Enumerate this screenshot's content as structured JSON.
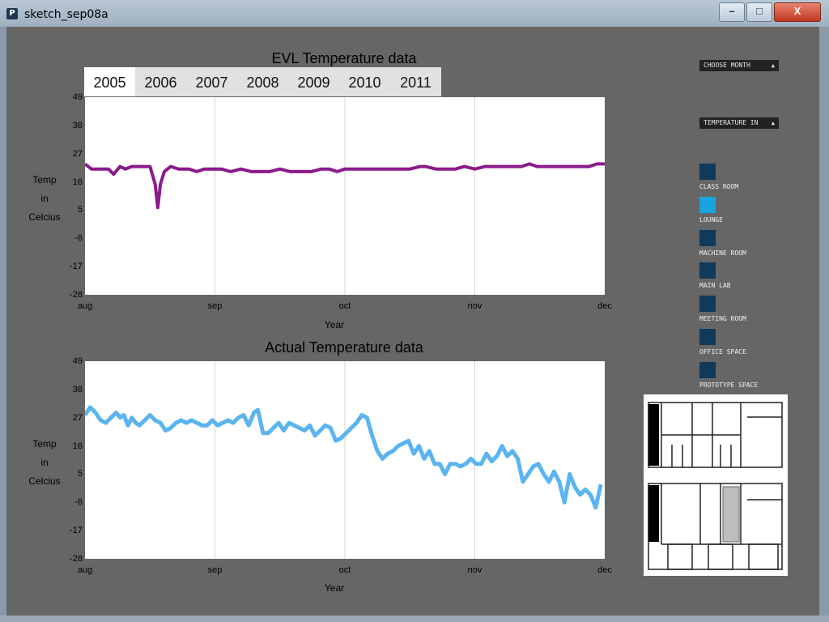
{
  "window": {
    "title": "sketch_sep08a",
    "app_icon": "processing-p-icon",
    "controls": {
      "minimize": "–",
      "maximize": "□",
      "close": "X"
    }
  },
  "tabs": [
    "2005",
    "2006",
    "2007",
    "2008",
    "2009",
    "2010",
    "2011"
  ],
  "selected_tab": "2005",
  "controls": {
    "choose_month": "CHOOSE MONTH",
    "temperature_in": "TEMPERATURE IN"
  },
  "rooms": [
    {
      "label": "CLASS ROOM",
      "color": "#0f3a5c"
    },
    {
      "label": "LOUNGE",
      "color": "#1aa3e0"
    },
    {
      "label": "MACHINE ROOM",
      "color": "#0f3a5c"
    },
    {
      "label": "MAIN LAB",
      "color": "#0f3a5c"
    },
    {
      "label": "MEETING ROOM",
      "color": "#0f3a5c"
    },
    {
      "label": "OFFICE SPACE",
      "color": "#0f3a5c"
    },
    {
      "label": "PROTOTYPE SPACE",
      "color": "#0f3a5c"
    }
  ],
  "chart_data": [
    {
      "type": "line",
      "title": "EVL Temperature data",
      "xlabel": "Year",
      "ylabel_lines": [
        "Temp",
        "in",
        "Celcius"
      ],
      "x_ticks": [
        "aug",
        "sep",
        "oct",
        "nov",
        "dec"
      ],
      "y_ticks": [
        49,
        38,
        27,
        16,
        5,
        -6,
        -17,
        -28
      ],
      "ylim": [
        -28,
        49
      ],
      "xlim": [
        0,
        4
      ],
      "grid": "vertical",
      "series": [
        {
          "color": "#8b1a8b",
          "points": [
            [
              0.0,
              23
            ],
            [
              0.05,
              21
            ],
            [
              0.12,
              21
            ],
            [
              0.18,
              21
            ],
            [
              0.22,
              19
            ],
            [
              0.27,
              22
            ],
            [
              0.31,
              21
            ],
            [
              0.36,
              22
            ],
            [
              0.42,
              22
            ],
            [
              0.47,
              22
            ],
            [
              0.5,
              22
            ],
            [
              0.54,
              15
            ],
            [
              0.56,
              6
            ],
            [
              0.58,
              15
            ],
            [
              0.61,
              20
            ],
            [
              0.66,
              22
            ],
            [
              0.72,
              21
            ],
            [
              0.8,
              21
            ],
            [
              0.86,
              20
            ],
            [
              0.92,
              21
            ],
            [
              0.98,
              21
            ],
            [
              1.05,
              21
            ],
            [
              1.12,
              20
            ],
            [
              1.2,
              21
            ],
            [
              1.28,
              20
            ],
            [
              1.34,
              20
            ],
            [
              1.42,
              20
            ],
            [
              1.5,
              21
            ],
            [
              1.58,
              20
            ],
            [
              1.66,
              20
            ],
            [
              1.74,
              20
            ],
            [
              1.82,
              21
            ],
            [
              1.88,
              21
            ],
            [
              1.94,
              20
            ],
            [
              2.0,
              21
            ],
            [
              2.1,
              21
            ],
            [
              2.2,
              21
            ],
            [
              2.3,
              21
            ],
            [
              2.4,
              21
            ],
            [
              2.5,
              21
            ],
            [
              2.58,
              22
            ],
            [
              2.62,
              22
            ],
            [
              2.7,
              21
            ],
            [
              2.78,
              21
            ],
            [
              2.85,
              21
            ],
            [
              2.92,
              22
            ],
            [
              3.0,
              21
            ],
            [
              3.08,
              22
            ],
            [
              3.14,
              22
            ],
            [
              3.22,
              22
            ],
            [
              3.28,
              22
            ],
            [
              3.36,
              22
            ],
            [
              3.42,
              23
            ],
            [
              3.48,
              22
            ],
            [
              3.56,
              22
            ],
            [
              3.64,
              22
            ],
            [
              3.72,
              22
            ],
            [
              3.8,
              22
            ],
            [
              3.88,
              22
            ],
            [
              3.94,
              23
            ],
            [
              4.0,
              23
            ]
          ]
        }
      ]
    },
    {
      "type": "line",
      "title": "Actual Temperature data",
      "xlabel": "Year",
      "ylabel_lines": [
        "Temp",
        "in",
        "Celcius"
      ],
      "x_ticks": [
        "aug",
        "sep",
        "oct",
        "nov",
        "dec"
      ],
      "y_ticks": [
        49,
        38,
        27,
        16,
        5,
        -6,
        -17,
        -28
      ],
      "ylim": [
        -28,
        49
      ],
      "xlim": [
        0,
        4
      ],
      "grid": "vertical",
      "series": [
        {
          "color": "#5ab4ef",
          "points": [
            [
              0.0,
              28
            ],
            [
              0.04,
              31
            ],
            [
              0.08,
              29
            ],
            [
              0.12,
              26
            ],
            [
              0.16,
              25
            ],
            [
              0.2,
              27
            ],
            [
              0.24,
              29
            ],
            [
              0.27,
              27
            ],
            [
              0.3,
              28
            ],
            [
              0.33,
              24
            ],
            [
              0.36,
              27
            ],
            [
              0.39,
              25
            ],
            [
              0.42,
              24
            ],
            [
              0.46,
              26
            ],
            [
              0.5,
              28
            ],
            [
              0.54,
              26
            ],
            [
              0.58,
              25
            ],
            [
              0.62,
              22
            ],
            [
              0.66,
              23
            ],
            [
              0.7,
              25
            ],
            [
              0.74,
              26
            ],
            [
              0.78,
              25
            ],
            [
              0.82,
              26
            ],
            [
              0.86,
              25
            ],
            [
              0.9,
              24
            ],
            [
              0.94,
              24
            ],
            [
              0.98,
              26
            ],
            [
              1.02,
              24
            ],
            [
              1.06,
              25
            ],
            [
              1.1,
              26
            ],
            [
              1.14,
              25
            ],
            [
              1.18,
              27
            ],
            [
              1.22,
              28
            ],
            [
              1.26,
              24
            ],
            [
              1.3,
              29
            ],
            [
              1.33,
              30
            ],
            [
              1.37,
              21
            ],
            [
              1.41,
              21
            ],
            [
              1.45,
              23
            ],
            [
              1.49,
              25
            ],
            [
              1.53,
              22
            ],
            [
              1.57,
              25
            ],
            [
              1.61,
              24
            ],
            [
              1.65,
              23
            ],
            [
              1.69,
              22
            ],
            [
              1.73,
              24
            ],
            [
              1.77,
              20
            ],
            [
              1.81,
              22
            ],
            [
              1.85,
              24
            ],
            [
              1.89,
              23
            ],
            [
              1.93,
              18
            ],
            [
              1.97,
              19
            ],
            [
              2.01,
              21
            ],
            [
              2.05,
              23
            ],
            [
              2.09,
              25
            ],
            [
              2.13,
              28
            ],
            [
              2.17,
              27
            ],
            [
              2.21,
              20
            ],
            [
              2.25,
              14
            ],
            [
              2.29,
              11
            ],
            [
              2.33,
              13
            ],
            [
              2.37,
              14
            ],
            [
              2.41,
              16
            ],
            [
              2.45,
              17
            ],
            [
              2.49,
              18
            ],
            [
              2.53,
              13
            ],
            [
              2.57,
              16
            ],
            [
              2.61,
              11
            ],
            [
              2.65,
              14
            ],
            [
              2.69,
              9
            ],
            [
              2.73,
              9
            ],
            [
              2.77,
              5
            ],
            [
              2.81,
              9
            ],
            [
              2.85,
              9
            ],
            [
              2.89,
              8
            ],
            [
              2.93,
              9
            ],
            [
              2.97,
              11
            ],
            [
              3.01,
              9
            ],
            [
              3.05,
              9
            ],
            [
              3.09,
              13
            ],
            [
              3.13,
              10
            ],
            [
              3.17,
              12
            ],
            [
              3.21,
              16
            ],
            [
              3.25,
              12
            ],
            [
              3.29,
              14
            ],
            [
              3.33,
              11
            ],
            [
              3.37,
              2
            ],
            [
              3.41,
              5
            ],
            [
              3.45,
              8
            ],
            [
              3.49,
              9
            ],
            [
              3.53,
              5
            ],
            [
              3.57,
              2
            ],
            [
              3.61,
              6
            ],
            [
              3.65,
              2
            ],
            [
              3.69,
              -6
            ],
            [
              3.73,
              5
            ],
            [
              3.77,
              0
            ],
            [
              3.81,
              -3
            ],
            [
              3.85,
              -1
            ],
            [
              3.89,
              -3
            ],
            [
              3.93,
              -8
            ],
            [
              3.97,
              1
            ],
            [
              4.01,
              6
            ],
            [
              4.05,
              0
            ],
            [
              4.09,
              -2
            ],
            [
              4.13,
              0
            ],
            [
              4.17,
              4
            ],
            [
              4.21,
              5
            ],
            [
              4.25,
              1
            ],
            [
              4.29,
              -4
            ],
            [
              4.33,
              -3
            ],
            [
              4.37,
              -5
            ],
            [
              4.41,
              0
            ],
            [
              4.45,
              -3
            ],
            [
              4.49,
              -7
            ],
            [
              4.53,
              -9
            ],
            [
              4.57,
              -11
            ],
            [
              4.61,
              -15
            ],
            [
              4.65,
              -11
            ],
            [
              4.69,
              -14
            ],
            [
              4.73,
              -13
            ],
            [
              4.77,
              -17
            ],
            [
              4.81,
              -16
            ],
            [
              4.85,
              -12
            ],
            [
              4.89,
              -16
            ],
            [
              4.93,
              -14
            ],
            [
              4.97,
              -12
            ],
            [
              5.01,
              -10
            ]
          ]
        }
      ]
    }
  ]
}
